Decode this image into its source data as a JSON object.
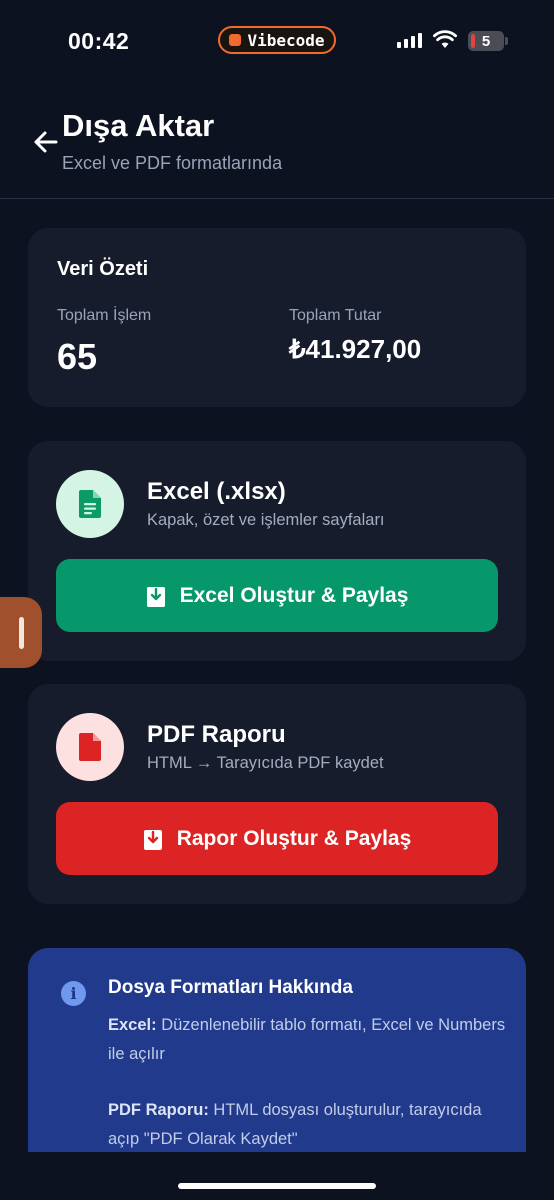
{
  "status": {
    "time": "00:42",
    "app_pill": "Vibecode",
    "battery": "5"
  },
  "header": {
    "title": "Dışa Aktar",
    "subtitle": "Excel ve PDF formatlarında"
  },
  "summary": {
    "title": "Veri Özeti",
    "total_count_label": "Toplam İşlem",
    "total_count": "65",
    "total_amount_label": "Toplam Tutar",
    "total_amount": "₺41.927,00"
  },
  "excel": {
    "title": "Excel (.xlsx)",
    "description": "Kapak, özet ve işlemler sayfaları",
    "button": "Excel Oluştur & Paylaş",
    "accent": "#06976a"
  },
  "pdf": {
    "title": "PDF Raporu",
    "description": "HTML → Tarayıcıda PDF kaydet",
    "button": "Rapor Oluştur & Paylaş",
    "accent": "#dc2424"
  },
  "info": {
    "title": "Dosya Formatları Hakkında",
    "excel_label": "Excel:",
    "excel_text": " Düzenlenebilir tablo formatı, Excel ve Numbers ile açılır",
    "pdf_label": "PDF Raporu:",
    "pdf_text": " HTML dosyası oluşturulur, tarayıcıda açıp \"PDF Olarak Kaydet\""
  },
  "icons": [
    "back-arrow-icon",
    "document-icon",
    "download-icon",
    "info-icon",
    "signal-icon",
    "wifi-icon"
  ]
}
